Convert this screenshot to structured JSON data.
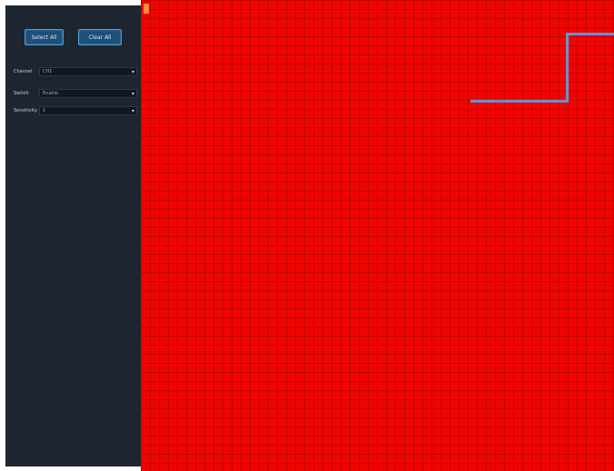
{
  "sidebar": {
    "buttons": [
      {
        "label": "Select All"
      },
      {
        "label": "Clear All"
      }
    ],
    "fields": [
      {
        "label": "Channel",
        "value": "CH1"
      },
      {
        "label": "Switch",
        "value": "Enable"
      },
      {
        "label": "Sensitivity",
        "value": "1"
      }
    ]
  },
  "grid": {
    "fill_color": "#ee0500",
    "line_color": "#6a8fd0"
  }
}
